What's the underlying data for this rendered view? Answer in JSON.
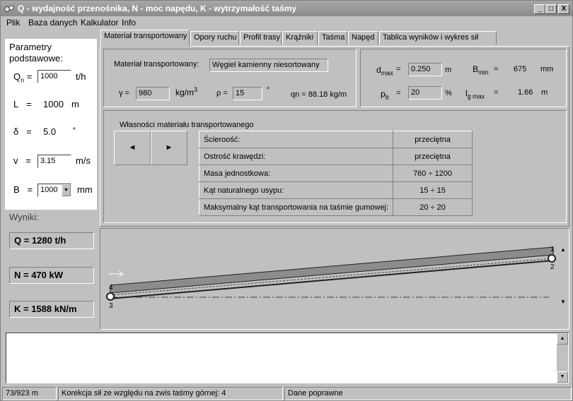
{
  "window": {
    "title": "Q - wydajność przenośnika, N - moc napędu,  K - wytrzymałość taśmy",
    "controls": [
      "_",
      "□",
      "X"
    ]
  },
  "menu": [
    "Plik",
    "Baza danych",
    "Kalkulator",
    "Info"
  ],
  "left": {
    "heading": "Parametry podstawowe:",
    "q_label": "Q",
    "q_sub": "n",
    "q_value": "1000",
    "q_unit": "t/h",
    "l_label": "L",
    "l_value": "1000",
    "l_unit": "m",
    "delta_label": "δ",
    "delta_value": "5.0",
    "delta_unit": "˚",
    "v_label": "v",
    "v_value": "3.15",
    "v_unit": "m/s",
    "b_label": "B",
    "b_value": "1000",
    "b_unit": "mm",
    "results_heading": "Wyniki:",
    "results": [
      "Q = 1280 t/h",
      "N = 470 kW",
      "K  = 1588 kN/m"
    ]
  },
  "tabs": [
    "Materiał transportowany",
    "Opory ruchu",
    "Profil trasy",
    "Krążniki",
    "Taśma",
    "Napęd",
    "Tablica wyników i wykres sił"
  ],
  "material": {
    "label": "Materiał transportowany:",
    "value": "Węgiel kamienny niesortowany",
    "gamma_label": "γ =",
    "gamma_value": "980",
    "gamma_unit": "kg/m",
    "gamma_unit_sup": "3",
    "rho_label": "ρ =",
    "rho_value": "15",
    "rho_unit": "°",
    "qn_text": "qn = 88.18 kg/m"
  },
  "right_params": {
    "dmax_label": "d",
    "dmax_sub": "max",
    "dmax_eq": "=",
    "dmax_value": "0.250",
    "dmax_unit": "m",
    "bmin_label": "B",
    "bmin_sub": "min",
    "bmin_eq": "=",
    "bmin_value": "675",
    "bmin_unit": "mm",
    "pb_label": "p",
    "pb_sub": "b",
    "pb_eq": "=",
    "pb_value": "20",
    "pb_unit": "%",
    "lg_label": "l",
    "lg_sub": "g max",
    "lg_eq": "=",
    "lg_value": "1.66",
    "lg_unit": "m"
  },
  "properties": {
    "heading": "Własności materiału transportowanego",
    "prev": "◄",
    "next": "►",
    "rows": [
      {
        "key": "Ścieroość:",
        "value": "przeciętna"
      },
      {
        "key": "Ostrość krawędzi:",
        "value": "przeciętna"
      },
      {
        "key": "Masa jednostkowa:",
        "value": "760   ÷   1200"
      },
      {
        "key": "Kąt naturalnego usypu:",
        "value": "15   ÷   15"
      },
      {
        "key": "Maksymalny kąt transportowania na taśmie gumowej:",
        "value": "20   ÷   20"
      }
    ]
  },
  "diagram": {
    "labels": [
      "1",
      "2",
      "3",
      "4"
    ]
  },
  "status": [
    "73/923 m",
    "Korekcja sił ze względu na zwis taśmy górnej: 4",
    "Dane poprawne"
  ]
}
